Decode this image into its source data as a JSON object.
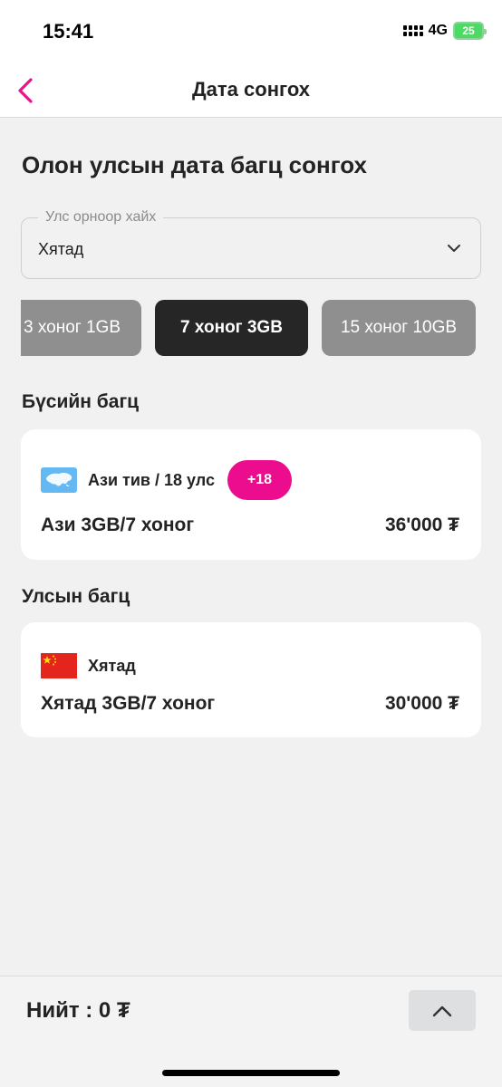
{
  "status_bar": {
    "time": "15:41",
    "network": "4G",
    "battery": "25"
  },
  "header": {
    "title": "Дата сонгох"
  },
  "main": {
    "heading": "Олон улсын дата багц сонгох",
    "country_select": {
      "label": "Улс орноор хайх",
      "value": "Хятад"
    },
    "duration_chips": [
      {
        "label": "3 хоног 1GB",
        "selected": false
      },
      {
        "label": "7 хоног 3GB",
        "selected": true
      },
      {
        "label": "15 хоног 10GB",
        "selected": false
      }
    ],
    "regional_section": {
      "title": "Бүсийн багц",
      "card": {
        "region": "Ази тив / 18 улс",
        "badge": "+18",
        "name": "Ази 3GB/7 хоног",
        "price": "36'000 ₮",
        "flag_icon": "asia-map-icon"
      }
    },
    "country_section": {
      "title": "Улсын багц",
      "card": {
        "region": "Хятад",
        "name": "Хятад 3GB/7 хоног",
        "price": "30'000 ₮",
        "flag_icon": "china-flag-icon"
      }
    }
  },
  "footer": {
    "total": "Нийт : 0 ₮"
  },
  "colors": {
    "accent": "#ec0d8f",
    "chip_active": "#262626",
    "chip_inactive": "#8f8f8f"
  }
}
